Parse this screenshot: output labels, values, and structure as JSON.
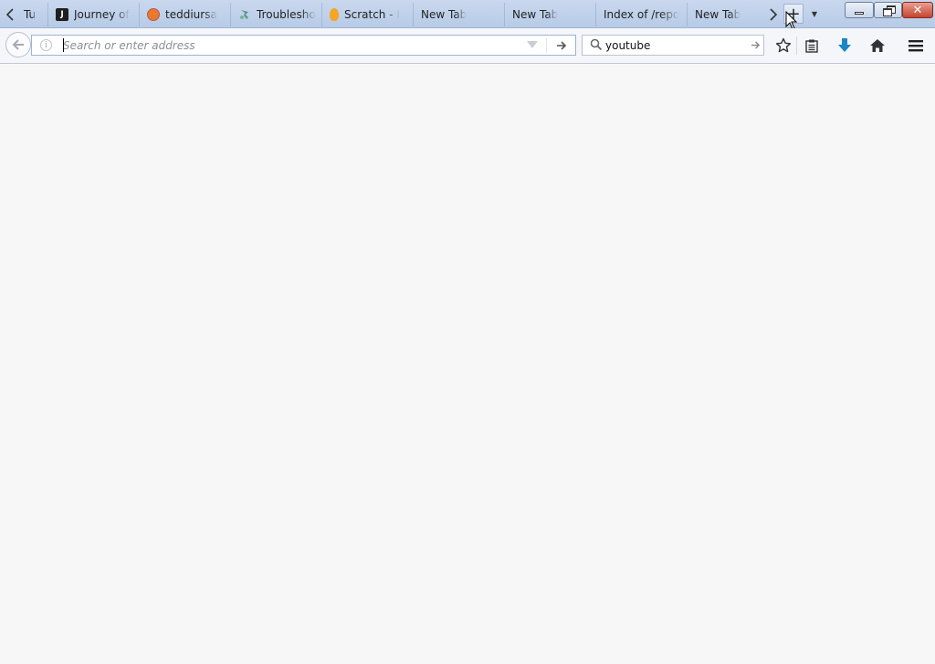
{
  "tabs": [
    {
      "label": "Tu",
      "icon": "none"
    },
    {
      "label": "Journey of",
      "icon": "j-logo-icon"
    },
    {
      "label": "teddiursa",
      "icon": "teddiursa-icon"
    },
    {
      "label": "Troublesho",
      "icon": "troubleshoot-icon"
    },
    {
      "label": "Scratch - I",
      "icon": "scratch-cat-icon"
    },
    {
      "label": "New Tab",
      "icon": "none"
    },
    {
      "label": "New Tab",
      "icon": "none"
    },
    {
      "label": "Index of /repo",
      "icon": "none"
    },
    {
      "label": "New Tab",
      "icon": "none"
    }
  ],
  "tab_controls": {
    "scroll_left": "‹",
    "scroll_right": "›",
    "new_tab": "+",
    "all_tabs": "▼"
  },
  "urlbar": {
    "placeholder": "Search or enter address",
    "value": ""
  },
  "searchbar": {
    "value": "youtube"
  },
  "colors": {
    "titlebar": "#c0d1ea",
    "toolbar": "#f4f6f9",
    "content": "#f7f7f8",
    "download_arrow": "#1a86c8"
  }
}
